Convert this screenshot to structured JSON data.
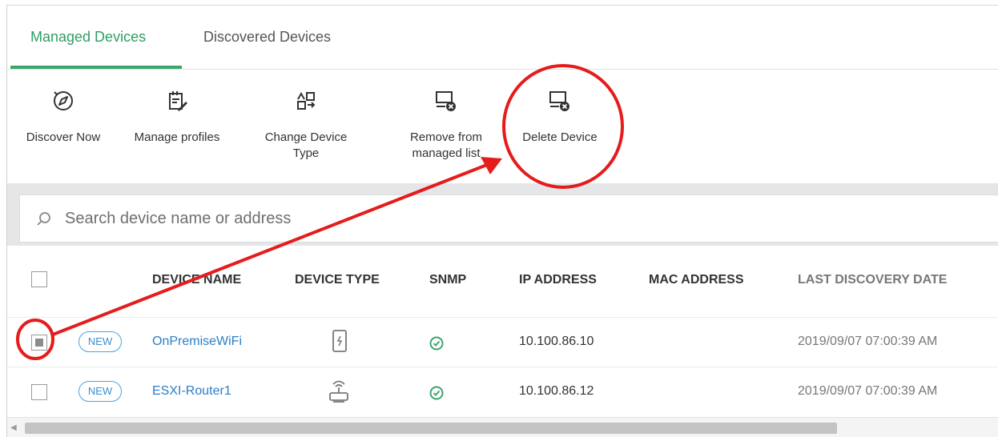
{
  "tabs": [
    {
      "label": "Managed Devices",
      "active": true
    },
    {
      "label": "Discovered Devices",
      "active": false
    }
  ],
  "toolbar": {
    "discover_now": "Discover Now",
    "manage_profiles": "Manage profiles",
    "change_type_line1": "Change Device",
    "change_type_line2": "Type",
    "remove_line1": "Remove from",
    "remove_line2": "managed list",
    "delete_device": "Delete Device"
  },
  "search": {
    "placeholder": "Search device name or address"
  },
  "table": {
    "headers": {
      "device_name": "DEVICE NAME",
      "device_type": "DEVICE TYPE",
      "snmp": "SNMP",
      "ip_address": "IP ADDRESS",
      "mac_address": "MAC ADDRESS",
      "last_discovery": "LAST DISCOVERY DATE"
    },
    "rows": [
      {
        "badge": "NEW",
        "name": "OnPremiseWiFi",
        "type_icon": "wifi-device-icon",
        "snmp": "check-circle-icon",
        "ip": "10.100.86.10",
        "mac": "",
        "last_discovery": "2019/09/07 07:00:39 AM",
        "checked": true
      },
      {
        "badge": "NEW",
        "name": "ESXI-Router1",
        "type_icon": "router-icon",
        "snmp": "check-circle-icon",
        "ip": "10.100.86.12",
        "mac": "",
        "last_discovery": "2019/09/07 07:00:39 AM",
        "checked": false
      }
    ]
  },
  "colors": {
    "accent_green": "#3aa56d",
    "link_blue": "#2a7ec7",
    "annotation_red": "#e51c1c"
  }
}
